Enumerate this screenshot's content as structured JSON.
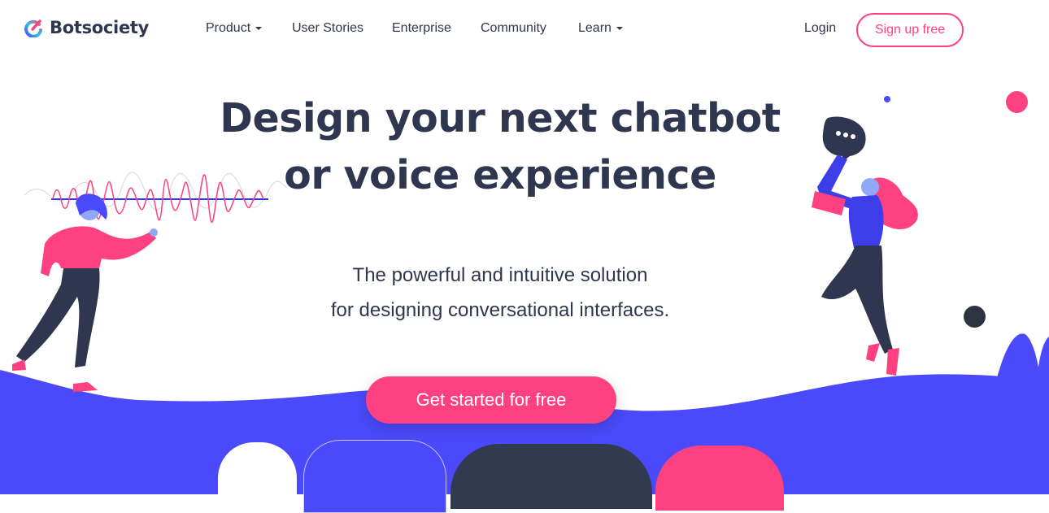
{
  "brand": {
    "name": "Botsociety",
    "colors": {
      "primary": "#4a4afc",
      "accent": "#ff4081",
      "text": "#2f3650",
      "dark": "#323a4f"
    }
  },
  "nav": {
    "items": [
      {
        "label": "Product",
        "has_dropdown": true
      },
      {
        "label": "User Stories",
        "has_dropdown": false
      },
      {
        "label": "Enterprise",
        "has_dropdown": false
      },
      {
        "label": "Community",
        "has_dropdown": false
      },
      {
        "label": "Learn",
        "has_dropdown": true
      }
    ],
    "login_label": "Login",
    "signup_label": "Sign up free"
  },
  "hero": {
    "headline_line1": "Design your next chatbot",
    "headline_line2": "or voice experience",
    "subtitle_line1": "The powerful and intuitive solution",
    "subtitle_line2": "for designing conversational interfaces.",
    "cta_label": "Get started for free"
  },
  "icons": {
    "logo": "botsociety-logo-icon",
    "dropdown": "caret-down-icon",
    "speech_bubble": "chat-bubble-icon"
  }
}
